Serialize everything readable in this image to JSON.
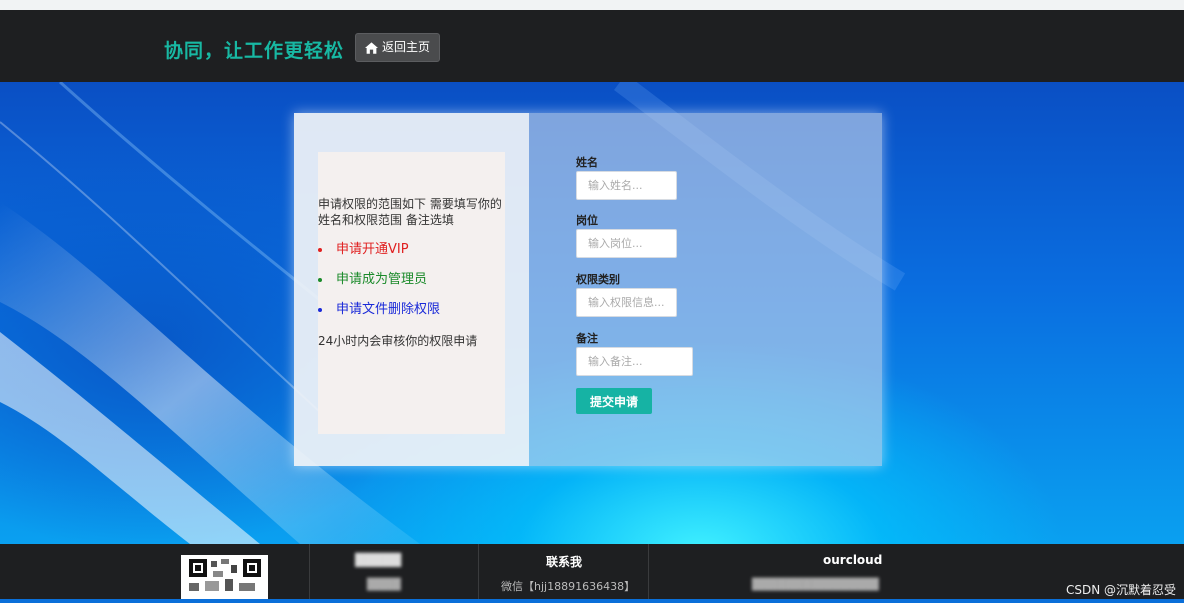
{
  "header": {
    "brand": "协同，让工作更轻松",
    "home_button": "返回主页"
  },
  "info": {
    "intro": "申请权限的范围如下 需要填写你的姓名和权限范围 备注选填",
    "items": [
      {
        "label": "申请开通VIP",
        "color": "#e02020"
      },
      {
        "label": "申请成为管理员",
        "color": "#1a8a2a"
      },
      {
        "label": "申请文件删除权限",
        "color": "#1a2ad8"
      }
    ],
    "footer": "24小时内会审核你的权限申请"
  },
  "form": {
    "name_label": "姓名",
    "name_placeholder": "输入姓名...",
    "position_label": "岗位",
    "position_placeholder": "输入岗位...",
    "perm_label": "权限类别",
    "perm_placeholder": "输入权限信息...",
    "remark_label": "备注",
    "remark_placeholder": "输入备注...",
    "submit": "提交申请"
  },
  "footer": {
    "contact_title": "联系我",
    "contact_wechat": "微信【hjj18891636438】",
    "ourcloud_title": "ourcloud",
    "watermark": "CSDN @沉默着忍受"
  },
  "colors": {
    "accent": "#18b8a3",
    "button": "#16b3a4"
  }
}
